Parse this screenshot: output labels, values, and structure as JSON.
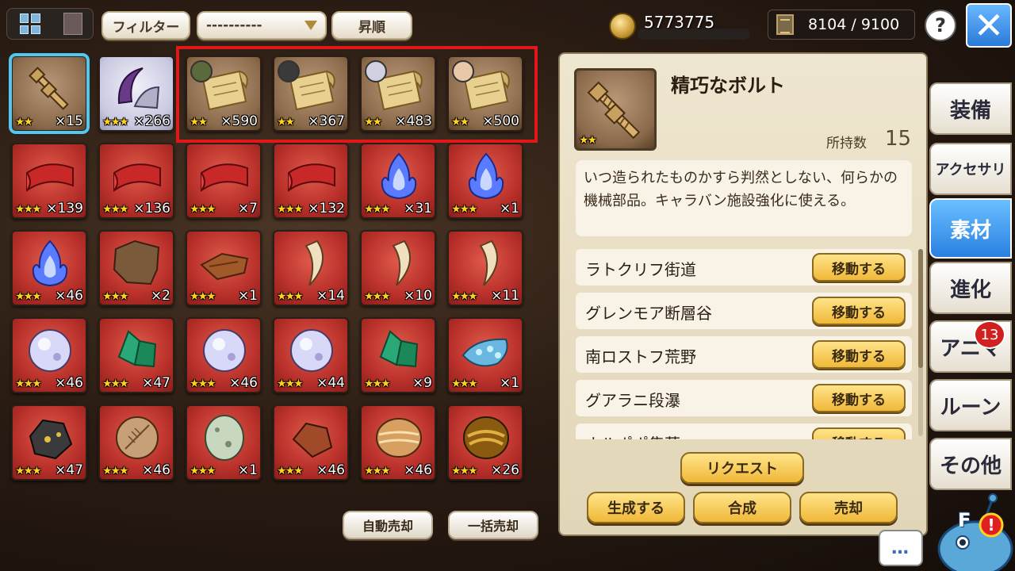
{
  "toolbar": {
    "filter_label": "フィルター",
    "dropdown_value": "----------",
    "sort_label": "昇順"
  },
  "gold": {
    "value": "5773775"
  },
  "capacity": {
    "value": "8104 / 9100"
  },
  "help": {
    "label": "?"
  },
  "items": [
    {
      "count": "×15",
      "stars": "★★",
      "bg": "brown",
      "art": "bolt",
      "selected": true
    },
    {
      "count": "×266",
      "stars": "★★★",
      "bg": "lavender",
      "art": "claw"
    },
    {
      "count": "×590",
      "stars": "★★",
      "bg": "brown",
      "art": "scroll",
      "face": "#5a6a3a"
    },
    {
      "count": "×367",
      "stars": "★★",
      "bg": "brown",
      "art": "scroll",
      "face": "#3a3a3a"
    },
    {
      "count": "×483",
      "stars": "★★",
      "bg": "brown",
      "art": "scroll",
      "face": "#d0d0e0"
    },
    {
      "count": "×500",
      "stars": "★★",
      "bg": "brown",
      "art": "scroll",
      "face": "#e8c8a8"
    },
    {
      "count": "×139",
      "stars": "★★★",
      "bg": "red",
      "art": "cloth"
    },
    {
      "count": "×136",
      "stars": "★★★",
      "bg": "red",
      "art": "cloth"
    },
    {
      "count": "×7",
      "stars": "★★★",
      "bg": "red",
      "art": "cloth"
    },
    {
      "count": "×132",
      "stars": "★★★",
      "bg": "red",
      "art": "cloth"
    },
    {
      "count": "×31",
      "stars": "★★★",
      "bg": "red",
      "art": "flame"
    },
    {
      "count": "×1",
      "stars": "★★★",
      "bg": "red",
      "art": "flame"
    },
    {
      "count": "×46",
      "stars": "★★★",
      "bg": "red",
      "art": "flame"
    },
    {
      "count": "×2",
      "stars": "★★★",
      "bg": "red",
      "art": "hide"
    },
    {
      "count": "×1",
      "stars": "★★★",
      "bg": "red",
      "art": "leather"
    },
    {
      "count": "×14",
      "stars": "★★★",
      "bg": "red",
      "art": "fang"
    },
    {
      "count": "×10",
      "stars": "★★★",
      "bg": "red",
      "art": "fang"
    },
    {
      "count": "×11",
      "stars": "★★★",
      "bg": "red",
      "art": "fang"
    },
    {
      "count": "×46",
      "stars": "★★★",
      "bg": "red",
      "art": "orb"
    },
    {
      "count": "×47",
      "stars": "★★★",
      "bg": "red",
      "art": "crystal"
    },
    {
      "count": "×46",
      "stars": "★★★",
      "bg": "red",
      "art": "orb"
    },
    {
      "count": "×44",
      "stars": "★★★",
      "bg": "red",
      "art": "orb"
    },
    {
      "count": "×9",
      "stars": "★★★",
      "bg": "red",
      "art": "crystal"
    },
    {
      "count": "×1",
      "stars": "★★★",
      "bg": "red",
      "art": "ore"
    },
    {
      "count": "×47",
      "stars": "★★★",
      "bg": "red",
      "art": "rock"
    },
    {
      "count": "×46",
      "stars": "★★★",
      "bg": "red",
      "art": "fossil"
    },
    {
      "count": "×1",
      "stars": "★★★",
      "bg": "red",
      "art": "egg"
    },
    {
      "count": "×46",
      "stars": "★★★",
      "bg": "red",
      "art": "stone"
    },
    {
      "count": "×46",
      "stars": "★★★",
      "bg": "red",
      "art": "agate"
    },
    {
      "count": "×26",
      "stars": "★★★",
      "bg": "red",
      "art": "tigereye"
    }
  ],
  "bottom": {
    "auto_sell": "自動売却",
    "bulk_sell": "一括売却"
  },
  "detail": {
    "name": "精巧なボルト",
    "stars": "★★",
    "owned_label": "所持数",
    "owned_value": "15",
    "description": "いつ造られたものかすら判然としない、何らかの機械部品。キャラバン施設強化に使える。",
    "locations": [
      {
        "name": "ラトクリフ街道",
        "button": "移動する"
      },
      {
        "name": "グレンモア断層谷",
        "button": "移動する"
      },
      {
        "name": "南ロストフ荒野",
        "button": "移動する"
      },
      {
        "name": "グアラニ段瀑",
        "button": "移動する"
      },
      {
        "name": "ホルポポ集落",
        "button": "移動する"
      }
    ],
    "request": "リクエスト",
    "create": "生成する",
    "synthesize": "合成",
    "sell": "売却"
  },
  "tabs": [
    {
      "label": "装備"
    },
    {
      "label": "アクセサリ"
    },
    {
      "label": "素材",
      "active": true
    },
    {
      "label": "進化"
    },
    {
      "label": "アニマ"
    },
    {
      "label": "ルーン"
    },
    {
      "label": "その他"
    }
  ],
  "badge": {
    "value": "13"
  },
  "chat": {
    "label": "…"
  },
  "mascot": {
    "label": "F"
  },
  "colors": {
    "accent_blue": "#2a80e0",
    "highlight_red": "#e01818",
    "selected_cyan": "#52c8f0",
    "star_gold": "#ffd020",
    "button_gold": "#f0b838"
  }
}
